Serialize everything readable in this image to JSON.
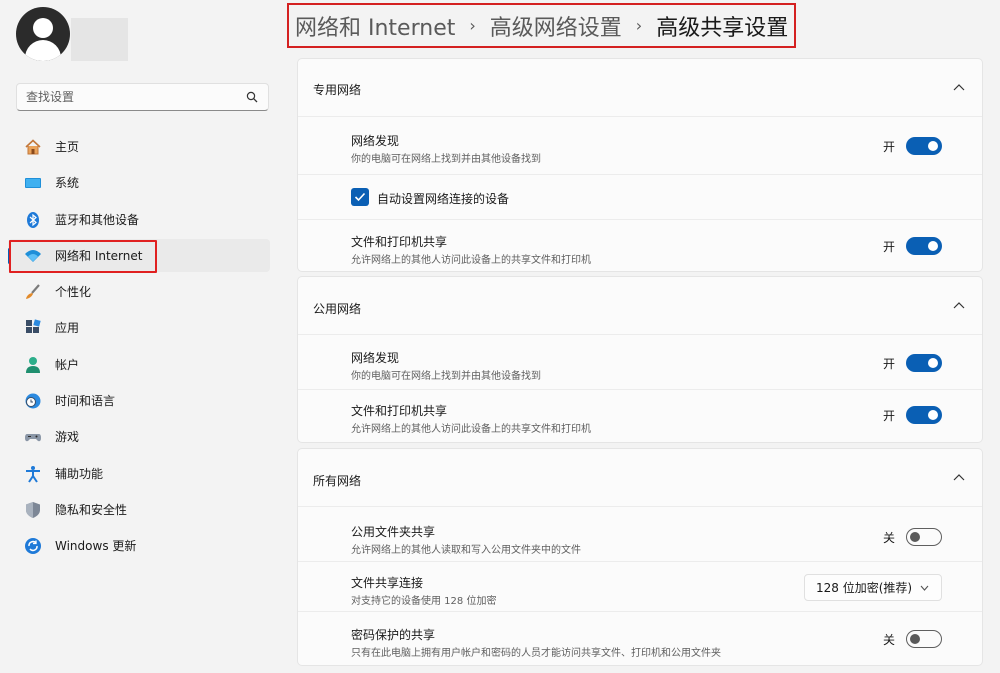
{
  "sidebar": {
    "search": {
      "placeholder": "查找设置",
      "icon": "search-icon"
    },
    "items": [
      {
        "label": "主页",
        "icon": "home-icon"
      },
      {
        "label": "系统",
        "icon": "system-icon"
      },
      {
        "label": "蓝牙和其他设备",
        "icon": "bluetooth-icon"
      },
      {
        "label": "网络和 Internet",
        "icon": "wifi-icon",
        "active": true
      },
      {
        "label": "个性化",
        "icon": "brush-icon"
      },
      {
        "label": "应用",
        "icon": "apps-icon"
      },
      {
        "label": "帐户",
        "icon": "account-icon"
      },
      {
        "label": "时间和语言",
        "icon": "clock-globe-icon"
      },
      {
        "label": "游戏",
        "icon": "gamepad-icon"
      },
      {
        "label": "辅助功能",
        "icon": "accessibility-icon"
      },
      {
        "label": "隐私和安全性",
        "icon": "shield-icon"
      },
      {
        "label": "Windows 更新",
        "icon": "update-icon"
      }
    ]
  },
  "breadcrumb": {
    "items": [
      "网络和 Internet",
      "高级网络设置",
      "高级共享设置"
    ],
    "separator": "›"
  },
  "colors": {
    "accent": "#0a5fb4",
    "highlight": "#d42020",
    "background": "#f3f3f3"
  },
  "sections": [
    {
      "title": "专用网络",
      "rows": [
        {
          "title": "网络发现",
          "desc": "你的电脑可在网络上找到并由其他设备找到",
          "state": "开",
          "on": true
        },
        {
          "checkbox_label": "自动设置网络连接的设备",
          "checked": true
        },
        {
          "title": "文件和打印机共享",
          "desc": "允许网络上的其他人访问此设备上的共享文件和打印机",
          "state": "开",
          "on": true
        }
      ]
    },
    {
      "title": "公用网络",
      "rows": [
        {
          "title": "网络发现",
          "desc": "你的电脑可在网络上找到并由其他设备找到",
          "state": "开",
          "on": true
        },
        {
          "title": "文件和打印机共享",
          "desc": "允许网络上的其他人访问此设备上的共享文件和打印机",
          "state": "开",
          "on": true
        }
      ]
    },
    {
      "title": "所有网络",
      "rows": [
        {
          "title": "公用文件夹共享",
          "desc": "允许网络上的其他人读取和写入公用文件夹中的文件",
          "state": "关",
          "on": false
        },
        {
          "title": "文件共享连接",
          "desc": "对支持它的设备使用 128 位加密",
          "dropdown_value": "128 位加密(推荐)"
        },
        {
          "title": "密码保护的共享",
          "desc": "只有在此电脑上拥有用户帐户和密码的人员才能访问共享文件、打印机和公用文件夹",
          "state": "关",
          "on": false
        }
      ]
    }
  ]
}
